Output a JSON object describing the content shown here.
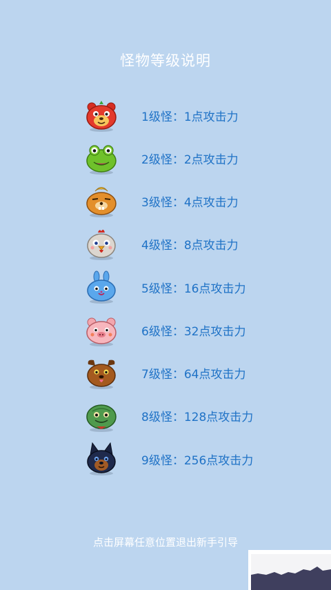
{
  "title": "怪物等级说明",
  "monsters": [
    {
      "text": "1级怪：1点攻击力",
      "icon": "red-bear-monster-icon"
    },
    {
      "text": "2级怪：2点攻击力",
      "icon": "green-frog-monster-icon"
    },
    {
      "text": "3级怪：4点攻击力",
      "icon": "orange-lion-monster-icon"
    },
    {
      "text": "4级怪：8点攻击力",
      "icon": "white-chicken-monster-icon"
    },
    {
      "text": "5级怪：16点攻击力",
      "icon": "blue-rabbit-monster-icon"
    },
    {
      "text": "6级怪：32点攻击力",
      "icon": "pink-pig-monster-icon"
    },
    {
      "text": "7级怪：64点攻击力",
      "icon": "brown-dog-monster-icon"
    },
    {
      "text": "8级怪：128点攻击力",
      "icon": "green-turtle-monster-icon"
    },
    {
      "text": "9级怪：256点攻击力",
      "icon": "dark-wolf-monster-icon"
    }
  ],
  "footer": "点击屏幕任意位置退出新手引导",
  "colors": {
    "background": "#bcd5ef",
    "level_text": "#1f72c6",
    "title_text": "#ffffff"
  }
}
